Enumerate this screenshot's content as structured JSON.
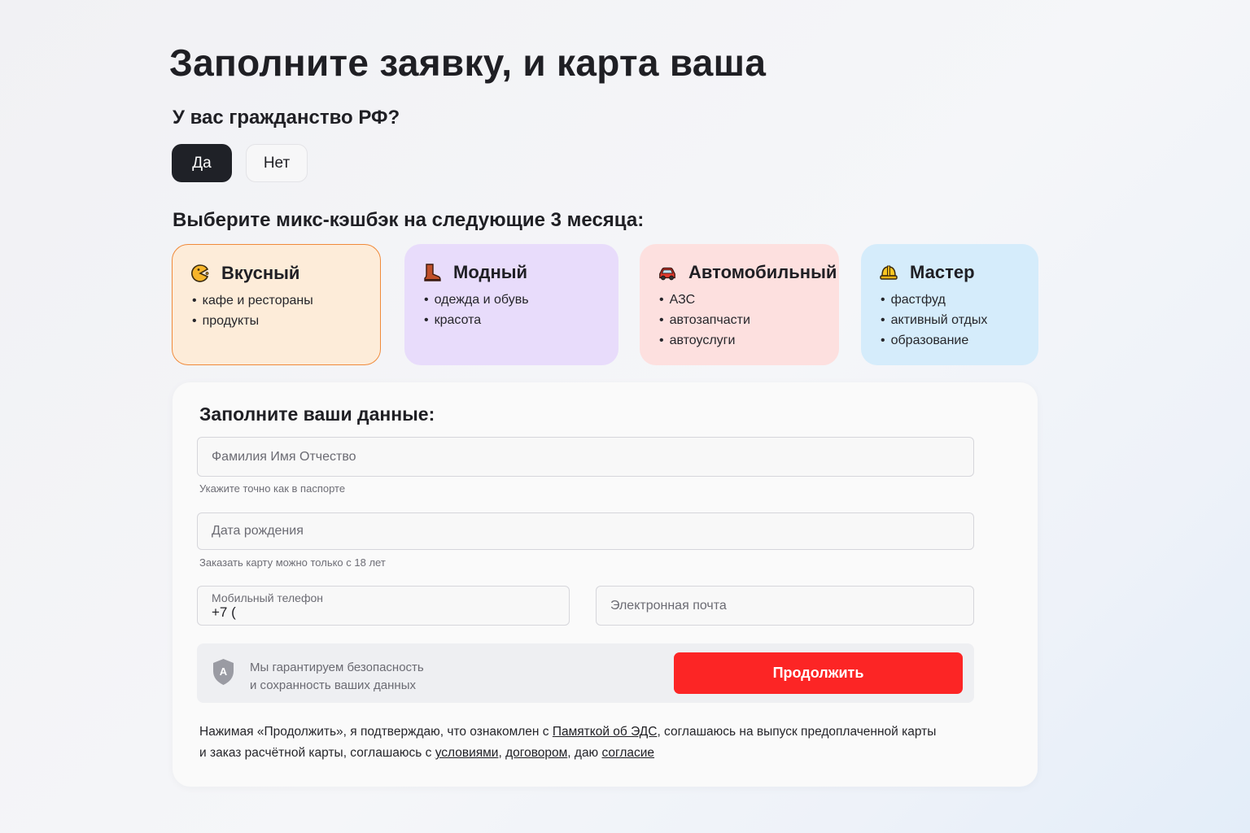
{
  "page_title": "Заполните заявку, и карта ваша",
  "citizenship": {
    "question": "У вас гражданство РФ?",
    "yes_label": "Да",
    "no_label": "Нет",
    "selected": "Да"
  },
  "cashback": {
    "title": "Выберите микс-кэшбэк на следующие 3 месяца:",
    "selected": "Вкусный",
    "cards": [
      {
        "name": "Вкусный",
        "icon": "pacman-food-icon",
        "color": "#fdecd9",
        "items": [
          "кафе и рестораны",
          "продукты"
        ]
      },
      {
        "name": "Модный",
        "icon": "boot-icon",
        "color": "#e8dcfb",
        "items": [
          "одежда и обувь",
          "красота"
        ]
      },
      {
        "name": "Автомобильный",
        "icon": "car-icon",
        "color": "#fde0df",
        "items": [
          "АЗС",
          "автозапчасти",
          "автоуслуги"
        ]
      },
      {
        "name": "Мастер",
        "icon": "helmet-icon",
        "color": "#d5ecfb",
        "items": [
          "фастфуд",
          "активный отдых",
          "образование"
        ]
      }
    ]
  },
  "form": {
    "title": "Заполните ваши данные:",
    "fio_placeholder": "Фамилия Имя Отчество",
    "fio_hint": "Укажите точно как в паспорте",
    "dob_placeholder": "Дата рождения",
    "dob_hint": "Заказать карту можно только с 18 лет",
    "phone_label": "Мобильный телефон",
    "phone_value": "+7 (",
    "email_placeholder": "Электронная почта",
    "security_line1": "Мы гарантируем безопасность",
    "security_line2": "и сохранность ваших данных",
    "continue_label": "Продолжить",
    "accent_color": "#fc2525"
  },
  "legal": {
    "part1": "Нажимая «Продолжить», я подтверждаю, что ознакомлен с ",
    "link_memo": "Памяткой об ЭДС",
    "part2": ", соглашаюсь на выпуск предоплаченной карты",
    "part3": "и заказ расчётной карты, соглашаюсь с ",
    "link_terms": "условиями",
    "sep": ", ",
    "link_contract": "договором",
    "part4": ", даю ",
    "link_consent": "согласие"
  }
}
